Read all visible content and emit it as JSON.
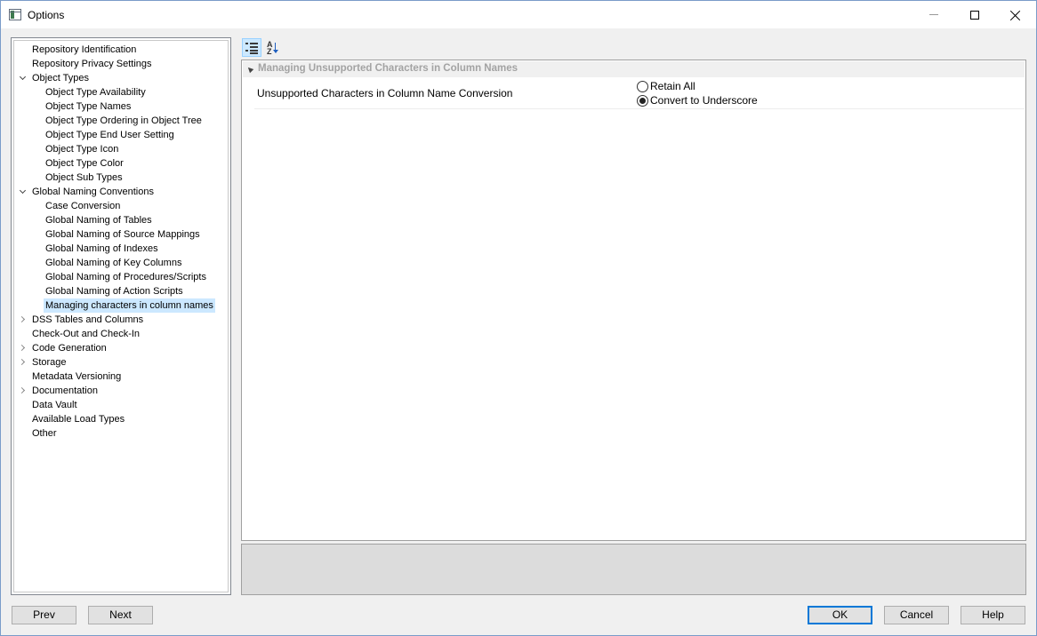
{
  "window": {
    "title": "Options"
  },
  "tree": {
    "items": [
      {
        "label": "Repository Identification",
        "level": 0,
        "expander": "none"
      },
      {
        "label": "Repository Privacy Settings",
        "level": 0,
        "expander": "none"
      },
      {
        "label": "Object Types",
        "level": 0,
        "expander": "expanded"
      },
      {
        "label": "Object Type Availability",
        "level": 1,
        "expander": "none"
      },
      {
        "label": "Object Type Names",
        "level": 1,
        "expander": "none"
      },
      {
        "label": "Object Type Ordering in Object Tree",
        "level": 1,
        "expander": "none"
      },
      {
        "label": "Object Type End User Setting",
        "level": 1,
        "expander": "none"
      },
      {
        "label": "Object Type Icon",
        "level": 1,
        "expander": "none"
      },
      {
        "label": "Object Type Color",
        "level": 1,
        "expander": "none"
      },
      {
        "label": "Object Sub Types",
        "level": 1,
        "expander": "none"
      },
      {
        "label": "Global Naming Conventions",
        "level": 0,
        "expander": "expanded"
      },
      {
        "label": "Case Conversion",
        "level": 1,
        "expander": "none"
      },
      {
        "label": "Global Naming of Tables",
        "level": 1,
        "expander": "none"
      },
      {
        "label": "Global Naming of Source Mappings",
        "level": 1,
        "expander": "none"
      },
      {
        "label": "Global Naming of Indexes",
        "level": 1,
        "expander": "none"
      },
      {
        "label": "Global Naming of Key Columns",
        "level": 1,
        "expander": "none"
      },
      {
        "label": "Global Naming of Procedures/Scripts",
        "level": 1,
        "expander": "none"
      },
      {
        "label": "Global Naming of Action Scripts",
        "level": 1,
        "expander": "none"
      },
      {
        "label": "Managing characters in column names",
        "level": 1,
        "expander": "none",
        "selected": true
      },
      {
        "label": "DSS Tables and Columns",
        "level": 0,
        "expander": "collapsed"
      },
      {
        "label": "Check-Out and Check-In",
        "level": 0,
        "expander": "none"
      },
      {
        "label": "Code Generation",
        "level": 0,
        "expander": "collapsed"
      },
      {
        "label": "Storage",
        "level": 0,
        "expander": "collapsed"
      },
      {
        "label": "Metadata Versioning",
        "level": 0,
        "expander": "none"
      },
      {
        "label": "Documentation",
        "level": 0,
        "expander": "collapsed"
      },
      {
        "label": "Data Vault",
        "level": 0,
        "expander": "none"
      },
      {
        "label": "Available Load Types",
        "level": 0,
        "expander": "none"
      },
      {
        "label": "Other",
        "level": 0,
        "expander": "none"
      }
    ]
  },
  "toolbar": {
    "categorized_icon": "categorized-view-icon",
    "alphabetical_icon": "sort-alphabetical-icon"
  },
  "property_grid": {
    "category": "Managing Unsupported Characters in Column Names",
    "property_name": "Unsupported Characters in Column Name Conversion",
    "options": [
      {
        "label": "Retain All",
        "checked": false
      },
      {
        "label": "Convert to Underscore",
        "checked": true
      }
    ]
  },
  "buttons": {
    "prev": "Prev",
    "next": "Next",
    "ok": "OK",
    "cancel": "Cancel",
    "help": "Help"
  }
}
